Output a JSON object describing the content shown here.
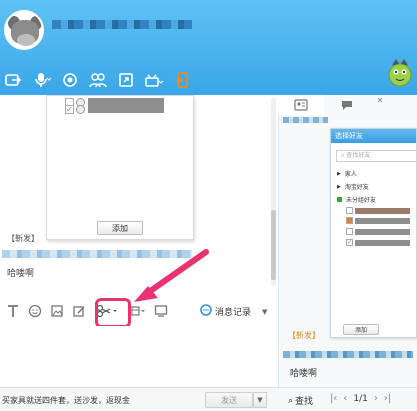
{
  "header": {
    "colors": {
      "gradient_top": "#5fc2f4",
      "gradient_bottom": "#3aa6e8"
    },
    "toolbar_icons": [
      "share-icon",
      "microphone-icon",
      "video-icon",
      "group-icon",
      "remote-desktop-icon",
      "app-icon",
      "file-transfer-icon"
    ]
  },
  "chat": {
    "screenshot_popup": {
      "add_button": "添加"
    },
    "sender": "【靳发】",
    "message": "哈喽啊"
  },
  "input_toolbar": {
    "icons": [
      "font-icon",
      "emoji-icon",
      "image-icon",
      "edit-icon",
      "scissors-icon",
      "more-icon",
      "screen-icon"
    ],
    "history_label": "消息记录",
    "highlight_color": "#e8336f"
  },
  "right_panel": {
    "dialog": {
      "title": "选择好友",
      "search_placeholder": "查找好友",
      "groups": [
        "家人",
        "淘宝好友",
        "未分组好友"
      ],
      "add_button": "添加"
    },
    "sender": "【靳发】",
    "message": "哈喽啊"
  },
  "bottom": {
    "ad_text": "买家具就送四件套，送沙发，返现金",
    "send": "发送",
    "search": "查找",
    "page": "1/1"
  }
}
